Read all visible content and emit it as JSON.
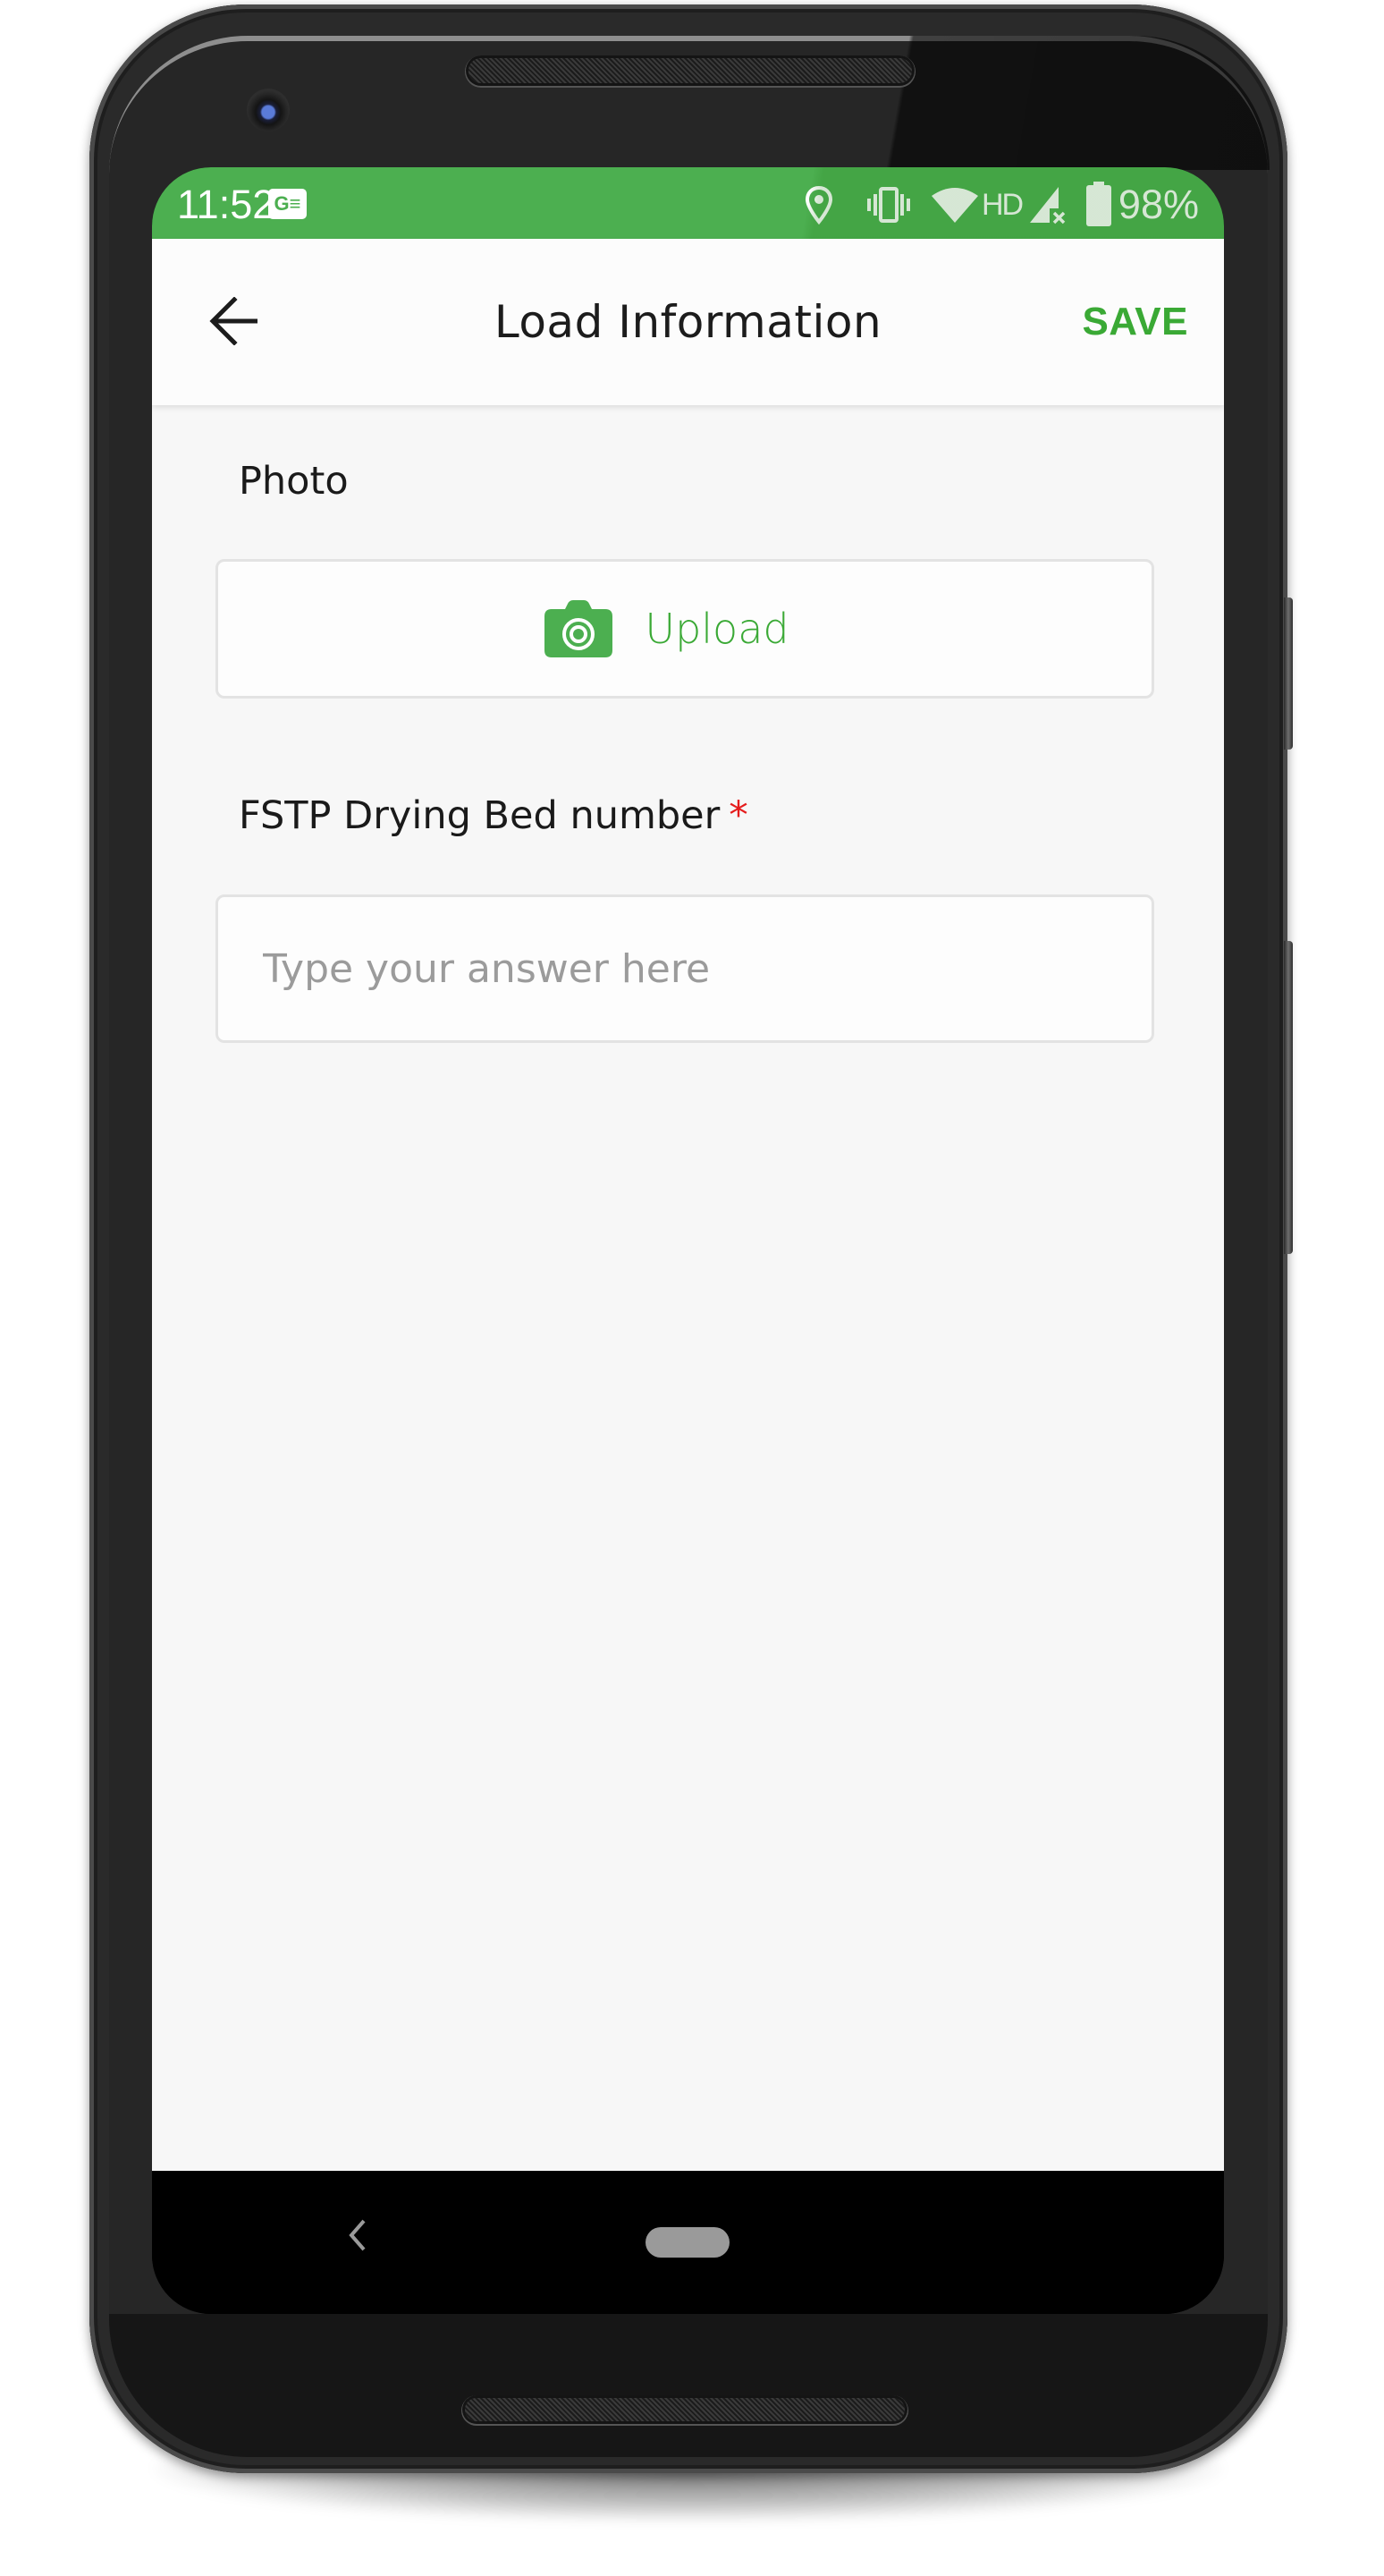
{
  "status_bar": {
    "time": "11:52",
    "app_notification_icon": "google-news-icon",
    "app_notification_glyph": "G≡",
    "icons": [
      "location-icon",
      "vibrate-icon",
      "wifi-icon",
      "hd-icon",
      "signal-no-service-icon",
      "battery-icon"
    ],
    "network_label": "HD",
    "battery_percent": "98%"
  },
  "app_bar": {
    "back_icon": "arrow-left-icon",
    "title": "Load Information",
    "save_label": "SAVE"
  },
  "form": {
    "photo": {
      "label": "Photo",
      "upload_icon": "camera-icon",
      "upload_label": "Upload"
    },
    "drying_bed": {
      "label": "FSTP Drying Bed number",
      "required_marker": "*",
      "value": "",
      "placeholder": "Type your answer here"
    }
  },
  "nav_bar": {
    "back_icon": "nav-back-icon",
    "home_icon": "nav-home-pill"
  },
  "colors": {
    "accent": "#4CAF50",
    "accent_text": "#3AA935",
    "required": "#E51C1C",
    "background": "#F7F7F7"
  }
}
